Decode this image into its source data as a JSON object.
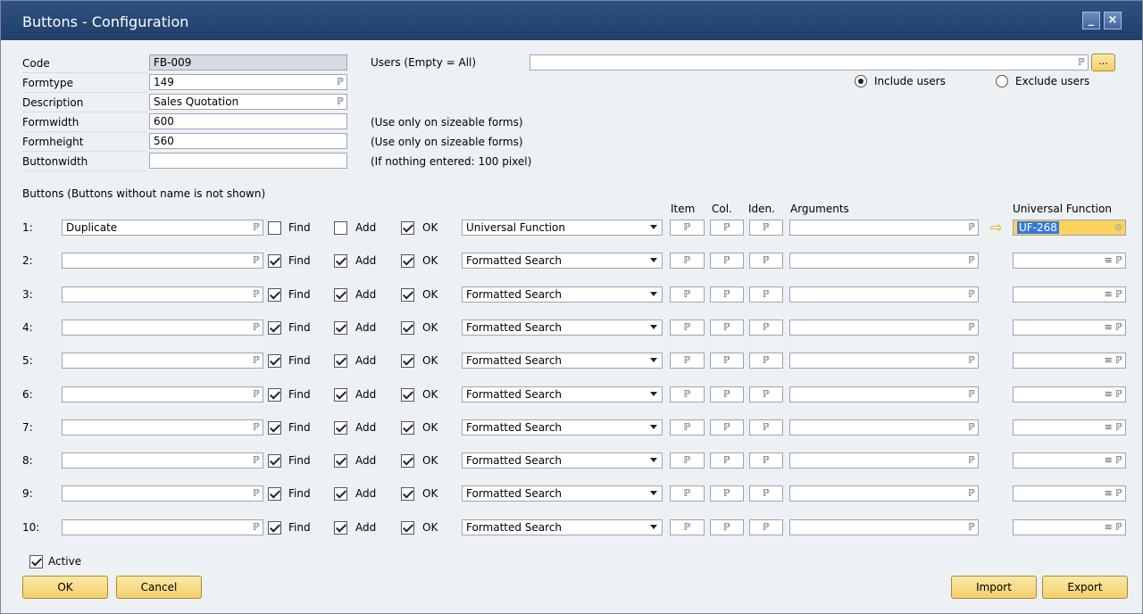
{
  "window": {
    "title": "Buttons - Configuration",
    "minimize_icon": "minimize-icon",
    "close_icon": "close-icon"
  },
  "header_fields": {
    "code": {
      "label": "Code",
      "value": "FB-009"
    },
    "formtype": {
      "label": "Formtype",
      "value": "149"
    },
    "description": {
      "label": "Description",
      "value": "Sales Quotation"
    },
    "formwidth": {
      "label": "Formwidth",
      "value": "600",
      "hint": "(Use only on sizeable forms)"
    },
    "formheight": {
      "label": "Formheight",
      "value": "560",
      "hint": "(Use only on sizeable forms)"
    },
    "buttonwidth": {
      "label": "Buttonwidth",
      "value": "",
      "hint": "(If nothing entered: 100 pixel)"
    }
  },
  "users": {
    "label": "Users (Empty = All)",
    "value": "",
    "browse_label": "...",
    "include_label": "Include users",
    "exclude_label": "Exclude users",
    "selected": "include"
  },
  "buttons_section": {
    "title": "Buttons (Buttons without name is not shown)",
    "headers": {
      "item": "Item",
      "col": "Col.",
      "iden": "Iden.",
      "arguments": "Arguments",
      "universal_function": "Universal Function"
    },
    "find_label": "Find",
    "add_label": "Add",
    "ok_label": "OK",
    "rows": [
      {
        "num": "1:",
        "name": "Duplicate",
        "find": false,
        "add": false,
        "ok": true,
        "type": "Universal Function",
        "uf": "UF-268"
      },
      {
        "num": "2:",
        "name": "",
        "find": true,
        "add": true,
        "ok": true,
        "type": "Formatted Search",
        "uf": ""
      },
      {
        "num": "3:",
        "name": "",
        "find": true,
        "add": true,
        "ok": true,
        "type": "Formatted Search",
        "uf": ""
      },
      {
        "num": "4:",
        "name": "",
        "find": true,
        "add": true,
        "ok": true,
        "type": "Formatted Search",
        "uf": ""
      },
      {
        "num": "5:",
        "name": "",
        "find": true,
        "add": true,
        "ok": true,
        "type": "Formatted Search",
        "uf": ""
      },
      {
        "num": "6:",
        "name": "",
        "find": true,
        "add": true,
        "ok": true,
        "type": "Formatted Search",
        "uf": ""
      },
      {
        "num": "7:",
        "name": "",
        "find": true,
        "add": true,
        "ok": true,
        "type": "Formatted Search",
        "uf": ""
      },
      {
        "num": "8:",
        "name": "",
        "find": true,
        "add": true,
        "ok": true,
        "type": "Formatted Search",
        "uf": ""
      },
      {
        "num": "9:",
        "name": "",
        "find": true,
        "add": true,
        "ok": true,
        "type": "Formatted Search",
        "uf": ""
      },
      {
        "num": "10:",
        "name": "",
        "find": true,
        "add": true,
        "ok": true,
        "type": "Formatted Search",
        "uf": ""
      }
    ]
  },
  "active": {
    "label": "Active",
    "checked": true
  },
  "footer": {
    "ok_label": "OK",
    "cancel_label": "Cancel",
    "import_label": "Import",
    "export_label": "Export"
  },
  "colors": {
    "titlebar": "#2a4a78",
    "button": "#f6d77a",
    "highlight": "#fbd35c",
    "selected_text": "#3a78d8"
  }
}
